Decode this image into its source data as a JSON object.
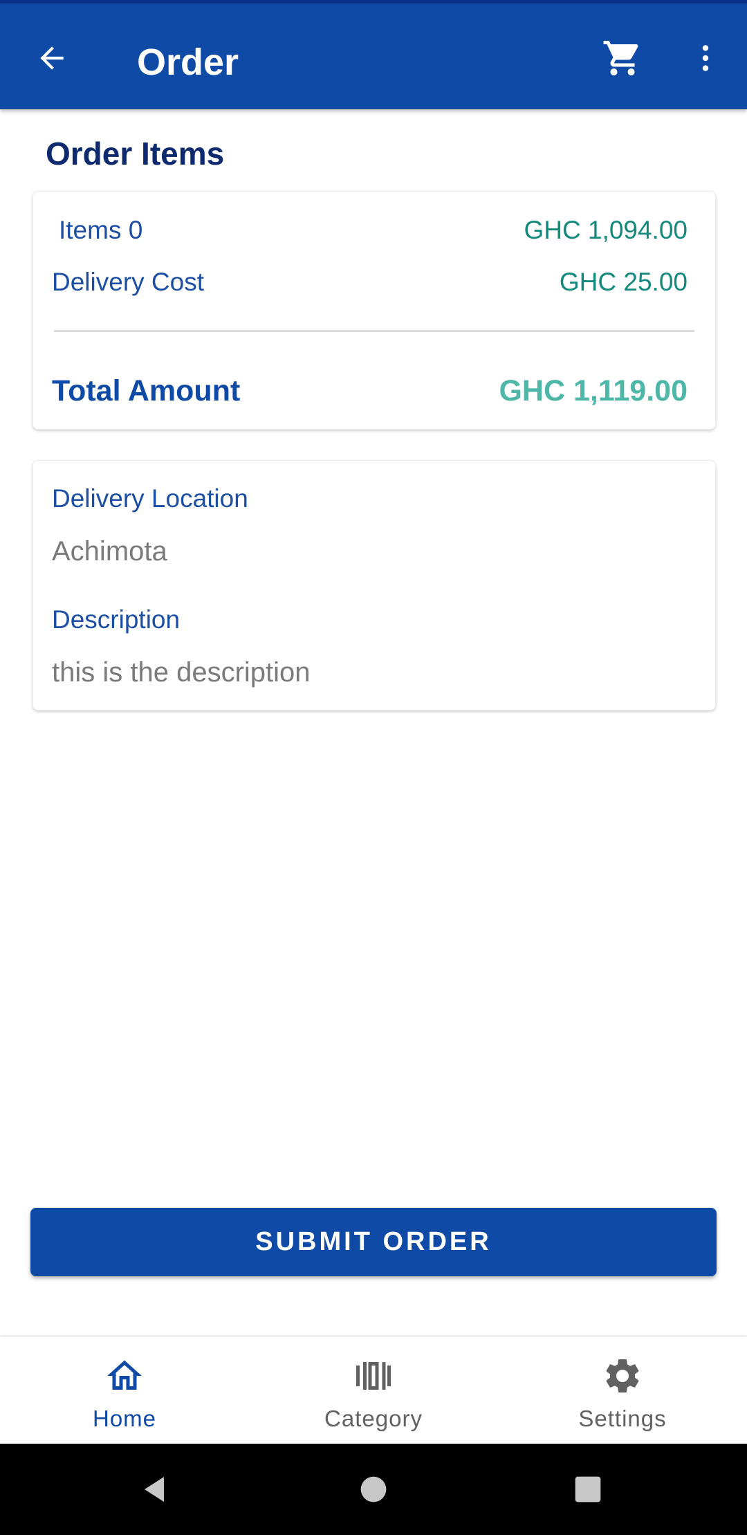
{
  "appbar": {
    "title": "Order",
    "back_icon": "arrow-left-icon",
    "cart_icon": "cart-icon",
    "menu_icon": "more-vert-icon",
    "color": "#0f4aa6"
  },
  "section": {
    "title": "Order Items"
  },
  "summary": {
    "items_label": "Items 0",
    "items_value": "GHC 1,094.00",
    "delivery_label": "Delivery Cost",
    "delivery_value": "GHC 25.00",
    "total_label": "Total Amount",
    "total_value": "GHC 1,119.00"
  },
  "details": {
    "location_label": "Delivery Location",
    "location_value": "Achimota",
    "description_label": "Description",
    "description_value": "this is the description"
  },
  "submit": {
    "label": "SUBMIT ORDER"
  },
  "bottom_nav": {
    "items": [
      {
        "label": "Home",
        "icon": "home-icon",
        "active": true
      },
      {
        "label": "Category",
        "icon": "category-carousel-icon",
        "active": false
      },
      {
        "label": "Settings",
        "icon": "gear-icon",
        "active": false
      }
    ]
  },
  "colors": {
    "primary": "#0f4aa6",
    "amount": "#12897c",
    "total_amount": "#4fb7a7",
    "heading": "#0d2a6e"
  }
}
